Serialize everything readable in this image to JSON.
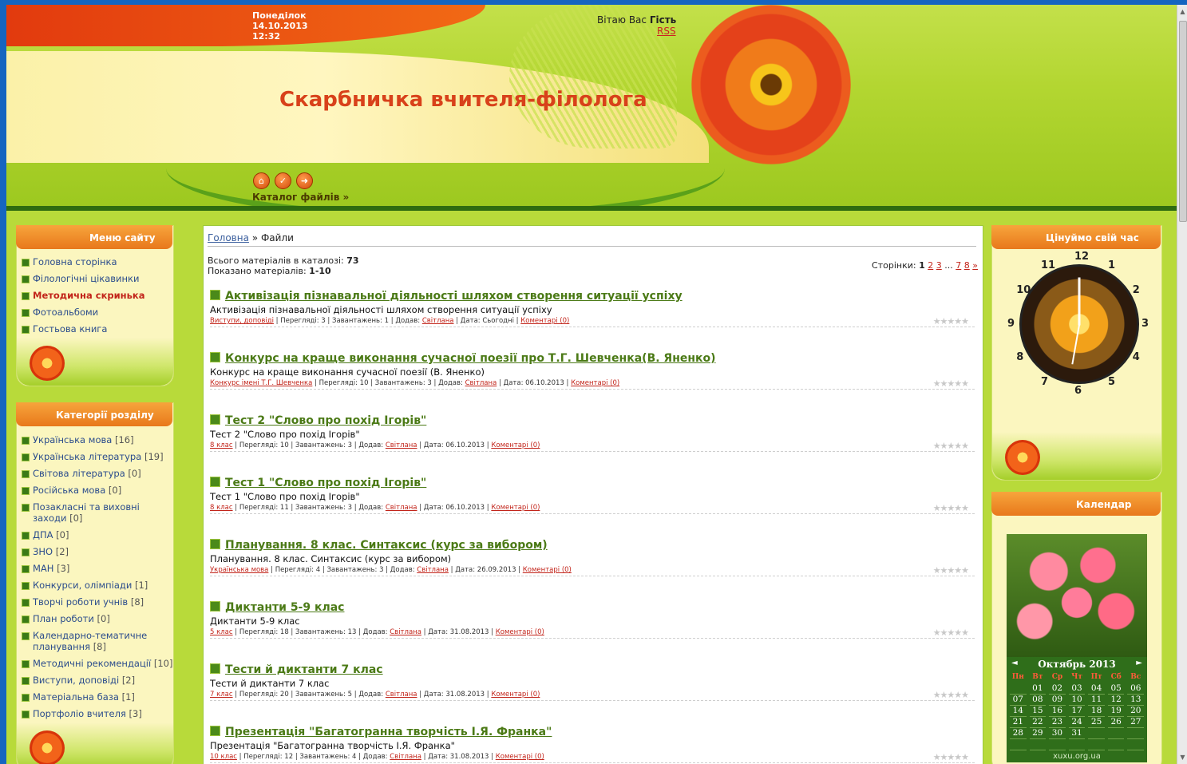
{
  "header": {
    "day": "Понеділок",
    "date": "14.10.2013",
    "time": "12:32",
    "greeting_prefix": "Вітаю Вас",
    "greeting_user": "Гість",
    "rss": "RSS",
    "site_title": "Скарбничка вчителя-філолога",
    "catalog_link": "Каталог файлів »",
    "icons": [
      "home-icon",
      "check-icon",
      "login-icon"
    ]
  },
  "menu": {
    "title": "Меню сайту",
    "items": [
      {
        "label": "Головна сторінка"
      },
      {
        "label": "Філологічні цікавинки"
      },
      {
        "label": "Методична скринька",
        "active": true
      },
      {
        "label": "Фотоальбоми"
      },
      {
        "label": "Гостьова книга"
      }
    ]
  },
  "categories": {
    "title": "Категорії розділу",
    "items": [
      {
        "label": "Українська мова",
        "count": "[16]"
      },
      {
        "label": "Українська література",
        "count": "[19]"
      },
      {
        "label": "Світова література",
        "count": "[0]"
      },
      {
        "label": "Російська мова",
        "count": "[0]"
      },
      {
        "label": "Позакласні та виховні заходи",
        "count": "[0]"
      },
      {
        "label": "ДПА",
        "count": "[0]"
      },
      {
        "label": "ЗНО",
        "count": "[2]"
      },
      {
        "label": "МАН",
        "count": "[3]"
      },
      {
        "label": "Конкурси, олімпіади",
        "count": "[1]"
      },
      {
        "label": "Творчі роботи учнів",
        "count": "[8]"
      },
      {
        "label": "План роботи",
        "count": "[0]"
      },
      {
        "label": "Календарно-тематичне планування",
        "count": "[8]"
      },
      {
        "label": "Методичні рекомендації",
        "count": "[10]"
      },
      {
        "label": "Виступи, доповіді",
        "count": "[2]"
      },
      {
        "label": "Матеріальна база",
        "count": "[1]"
      },
      {
        "label": "Портфоліо вчителя",
        "count": "[3]"
      }
    ]
  },
  "main": {
    "breadcrumb_home": "Головна",
    "breadcrumb_sep": "»",
    "breadcrumb_current": "Файли",
    "total_label": "Всього матеріалів в каталозі:",
    "total_value": "73",
    "shown_label": "Показано матеріалів:",
    "shown_value": "1-10",
    "pages_label": "Сторінки:",
    "pages": [
      "1",
      "2",
      "3",
      "...",
      "7",
      "8",
      "»"
    ],
    "items": [
      {
        "title": "Активізація пізнавальної діяльності шляхом створення ситуації успіху",
        "desc": "Активізація пізнавальної діяльності шляхом створення ситуації успіху",
        "category": "Виступи, доповіді",
        "views": "Перегляді: 3",
        "downloads": "Завантажень: 1",
        "added_label": "Додав:",
        "author": "Світлана",
        "date": "Дата: Сьогодні",
        "comments": "Коментарі (0)"
      },
      {
        "title": "Конкурс на краще виконання сучасної поезії про Т.Г. Шевченка(В. Яненко)",
        "desc": "Конкурс на краще виконання сучасної поезії (В. Яненко)",
        "category": "Конкурс імені Т.Г. Шевченка",
        "views": "Перегляді: 10",
        "downloads": "Завантажень: 3",
        "added_label": "Додав:",
        "author": "Світлана",
        "date": "Дата: 06.10.2013",
        "comments": "Коментарі (0)"
      },
      {
        "title": "Тест 2 \"Слово про похід Ігорів\"",
        "desc": "Тест 2 \"Слово про похід Ігорів\"",
        "category": "8 клас",
        "views": "Перегляді: 10",
        "downloads": "Завантажень: 3",
        "added_label": "Додав:",
        "author": "Світлана",
        "date": "Дата: 06.10.2013",
        "comments": "Коментарі (0)"
      },
      {
        "title": "Тест 1 \"Слово про похід Ігорів\"",
        "desc": "Тест 1 \"Слово про похід Ігорів\"",
        "category": "8 клас",
        "views": "Перегляді: 11",
        "downloads": "Завантажень: 3",
        "added_label": "Додав:",
        "author": "Світлана",
        "date": "Дата: 06.10.2013",
        "comments": "Коментарі (0)"
      },
      {
        "title": "Планування. 8 клас. Синтаксис (курс за вибором)",
        "desc": "Планування. 8 клас. Синтаксис (курс за вибором)",
        "category": "Українська мова",
        "views": "Перегляді: 4",
        "downloads": "Завантажень: 3",
        "added_label": "Додав:",
        "author": "Світлана",
        "date": "Дата: 26.09.2013",
        "comments": "Коментарі (0)"
      },
      {
        "title": "Диктанти 5-9 клас",
        "desc": "Диктанти 5-9 клас",
        "category": "5 клас",
        "views": "Перегляді: 18",
        "downloads": "Завантажень: 13",
        "added_label": "Додав:",
        "author": "Світлана",
        "date": "Дата: 31.08.2013",
        "comments": "Коментарі (0)"
      },
      {
        "title": "Тести й диктанти 7 клас",
        "desc": "Тести й диктанти 7 клас",
        "category": "7 клас",
        "views": "Перегляді: 20",
        "downloads": "Завантажень: 5",
        "added_label": "Додав:",
        "author": "Світлана",
        "date": "Дата: 31.08.2013",
        "comments": "Коментарі (0)"
      },
      {
        "title": "Презентація \"Багатогранна творчість І.Я. Франка\"",
        "desc": "Презентація \"Багатогранна творчість І.Я. Франка\"",
        "category": "10 клас",
        "views": "Перегляді: 12",
        "downloads": "Завантажень: 4",
        "added_label": "Додав:",
        "author": "Світлана",
        "date": "Дата: 31.08.2013",
        "comments": "Коментарі (0)"
      }
    ]
  },
  "clock_block": {
    "title": "Цінуймо свій час",
    "numbers": [
      "12",
      "1",
      "2",
      "3",
      "4",
      "5",
      "6",
      "7",
      "8",
      "9",
      "10",
      "11"
    ]
  },
  "calendar_block": {
    "title": "Календар",
    "month": "Октябрь 2013",
    "prev": "◄",
    "next": "►",
    "dows": [
      "Пн",
      "Вт",
      "Ср",
      "Чт",
      "Пт",
      "Сб",
      "Вс"
    ],
    "weeks": [
      [
        "",
        "01",
        "02",
        "03",
        "04",
        "05",
        "06"
      ],
      [
        "07",
        "08",
        "09",
        "10",
        "11",
        "12",
        "13"
      ],
      [
        "14",
        "15",
        "16",
        "17",
        "18",
        "19",
        "20"
      ],
      [
        "21",
        "22",
        "23",
        "24",
        "25",
        "26",
        "27"
      ],
      [
        "28",
        "29",
        "30",
        "31",
        "",
        "",
        ""
      ],
      [
        "",
        "",
        "",
        "",
        "",
        "",
        ""
      ]
    ],
    "footer": "xuxu.org.ua"
  },
  "colors": {
    "accent_orange": "#e8781b",
    "title_red": "#d8411a",
    "link_green": "#4b7a16",
    "link_red": "#c2241a"
  }
}
